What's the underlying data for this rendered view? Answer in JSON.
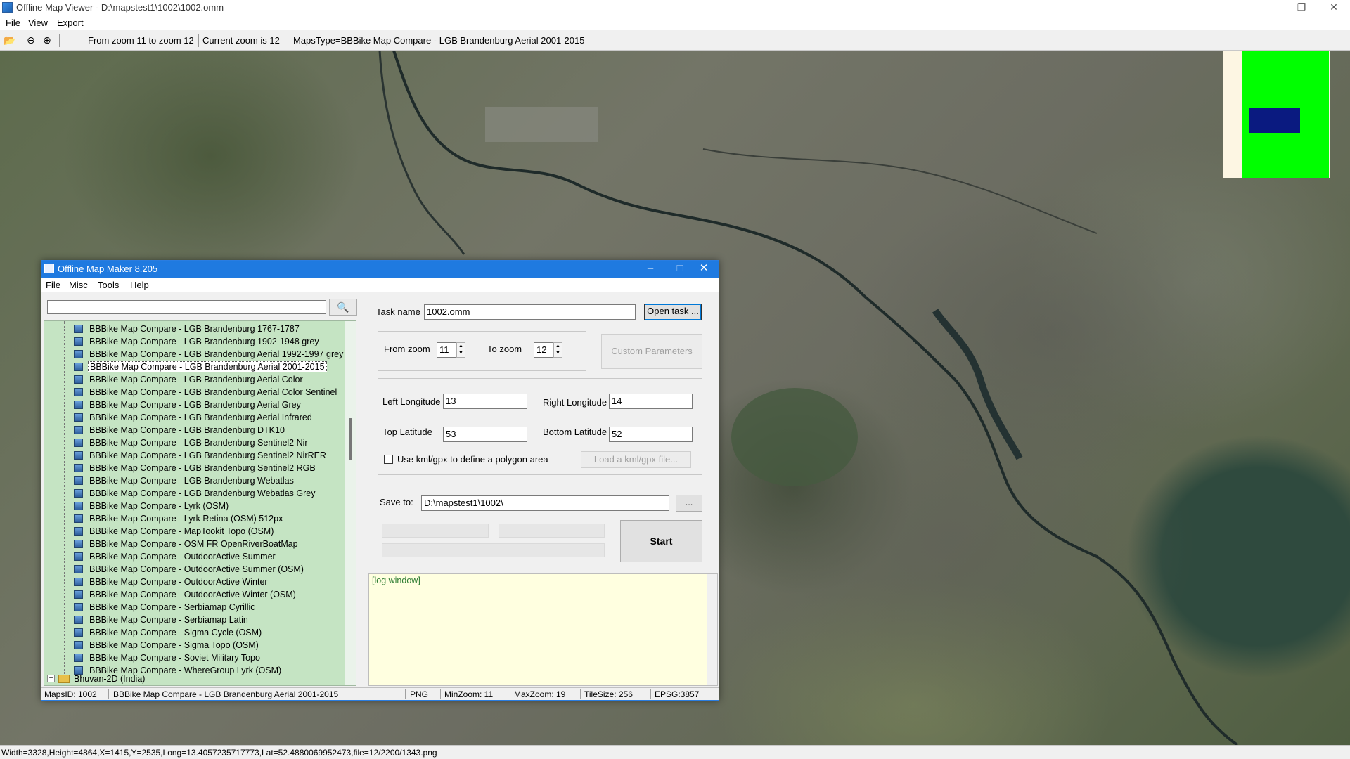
{
  "window": {
    "title": "Offline Map Viewer - D:\\mapstest1\\1002\\1002.omm",
    "menu": [
      "File",
      "View",
      "Export"
    ]
  },
  "toolbar": {
    "zoom_range": "From zoom 11 to zoom 12",
    "current_zoom": "Current zoom is 12",
    "maps_type": "MapsType=BBBike Map Compare - LGB Brandenburg Aerial 2001-2015"
  },
  "status_bar": {
    "text": "Width=3328,Height=4864,X=1415,Y=2535,Long=13.4057235717773,Lat=52.4880069952473,file=12/2200/1343.png"
  },
  "dialog": {
    "title": "Offline Map Maker 8.205",
    "menu": [
      "File",
      "Misc",
      "Tools",
      "Help"
    ],
    "search": {
      "value": "",
      "placeholder": ""
    },
    "tree_items": [
      "BBBike Map Compare - LGB Brandenburg 1767-1787",
      "BBBike Map Compare - LGB Brandenburg 1902-1948 grey",
      "BBBike Map Compare - LGB Brandenburg Aerial 1992-1997 grey",
      "BBBike Map Compare - LGB Brandenburg Aerial 2001-2015",
      "BBBike Map Compare - LGB Brandenburg Aerial Color",
      "BBBike Map Compare - LGB Brandenburg Aerial Color Sentinel",
      "BBBike Map Compare - LGB Brandenburg Aerial Grey",
      "BBBike Map Compare - LGB Brandenburg Aerial Infrared",
      "BBBike Map Compare - LGB Brandenburg DTK10",
      "BBBike Map Compare - LGB Brandenburg Sentinel2 Nir",
      "BBBike Map Compare - LGB Brandenburg Sentinel2 NirRER",
      "BBBike Map Compare - LGB Brandenburg Sentinel2 RGB",
      "BBBike Map Compare - LGB Brandenburg Webatlas",
      "BBBike Map Compare - LGB Brandenburg Webatlas Grey",
      "BBBike Map Compare - Lyrk (OSM)",
      "BBBike Map Compare - Lyrk Retina (OSM) 512px",
      "BBBike Map Compare - MapTookit Topo (OSM)",
      "BBBike Map Compare - OSM FR OpenRiverBoatMap",
      "BBBike Map Compare - OutdoorActive Summer",
      "BBBike Map Compare - OutdoorActive Summer (OSM)",
      "BBBike Map Compare - OutdoorActive Winter",
      "BBBike Map Compare - OutdoorActive Winter (OSM)",
      "BBBike Map Compare - Serbiamap Cyrillic",
      "BBBike Map Compare - Serbiamap Latin",
      "BBBike Map Compare - Sigma Cycle (OSM)",
      "BBBike Map Compare - Sigma Topo (OSM)",
      "BBBike Map Compare - Soviet Military Topo",
      "BBBike Map Compare - WhereGroup Lyrk (OSM)"
    ],
    "selected_index": 3,
    "folder_item": "Bhuvan-2D (India)",
    "task_name_label": "Task name",
    "task_name_value": "1002.omm",
    "open_task_label": "Open task ...",
    "from_zoom_label": "From zoom",
    "from_zoom_value": "11",
    "to_zoom_label": "To zoom",
    "to_zoom_value": "12",
    "custom_params_label": "Custom Parameters",
    "left_lon_label": "Left Longitude",
    "left_lon_value": "13",
    "right_lon_label": "Right Longitude",
    "right_lon_value": "14",
    "top_lat_label": "Top Latitude",
    "top_lat_value": "53",
    "bottom_lat_label": "Bottom Latitude",
    "bottom_lat_value": "52",
    "kml_checkbox_label": "Use kml/gpx to define a polygon area",
    "load_kml_label": "Load a kml/gpx file...",
    "save_to_label": "Save to:",
    "save_to_value": "D:\\mapstest1\\1002\\",
    "browse_label": "...",
    "start_label": "Start",
    "log_text": "[log window]",
    "status": {
      "maps_id": "MapsID: 1002",
      "map_name": "BBBike Map Compare - LGB Brandenburg Aerial 2001-2015",
      "format": "PNG",
      "min_zoom": "MinZoom: 11",
      "max_zoom": "MaxZoom: 19",
      "tile_size": "TileSize: 256",
      "epsg": "EPSG:3857"
    }
  },
  "colors": {
    "dialog_title_bg": "#1f7ae0",
    "tree_bg": "#c5e4c3",
    "log_bg": "#ffffe0",
    "overview_green": "#00ff00",
    "overview_view": "#0a1a80"
  }
}
